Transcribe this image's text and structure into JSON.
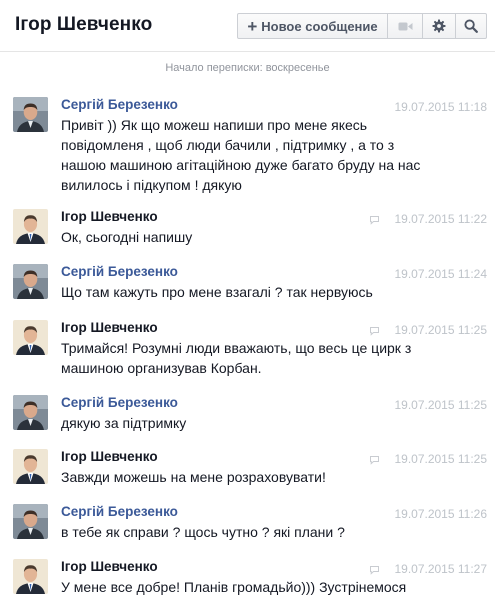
{
  "header": {
    "title": "Ігор Шевченко",
    "new_message_label": "Новое сообщение"
  },
  "conversation_start": "Начало переписки: воскресенье",
  "messages": [
    {
      "sender": "Сергій Березенко",
      "time": "19.07.2015 11:18",
      "text": "Привіт )) Як що можеш напиши про мене якесь повідомленя , щоб люди бачили , підтримку , а то з нашою машиною агітаційною дуже багато бруду на нас вилилось і підкупом ! дякую"
    },
    {
      "sender": "Ігор Шевченко",
      "time": "19.07.2015 11:22",
      "text": "Ок, сьогодні напишу"
    },
    {
      "sender": "Сергій Березенко",
      "time": "19.07.2015 11:24",
      "text": "Що там кажуть про мене взагалі ? так нервуюсь"
    },
    {
      "sender": "Ігор Шевченко",
      "time": "19.07.2015 11:25",
      "text": "Тримайся! Розумні люди вважають, що весь це цирк з машиною организував Корбан."
    },
    {
      "sender": "Сергій Березенко",
      "time": "19.07.2015 11:25",
      "text": "дякую за підтримку"
    },
    {
      "sender": "Ігор Шевченко",
      "time": "19.07.2015 11:25",
      "text": "Завжди можешь на мене розраховувати!"
    },
    {
      "sender": "Сергій Березенко",
      "time": "19.07.2015 11:26",
      "text": "в тебе як справи ? щось чутно ? які плани ?"
    },
    {
      "sender": "Ігор Шевченко",
      "time": "19.07.2015 11:27",
      "text": "У мене все добре! Планів громадьйо))) Зустрінемося"
    }
  ]
}
